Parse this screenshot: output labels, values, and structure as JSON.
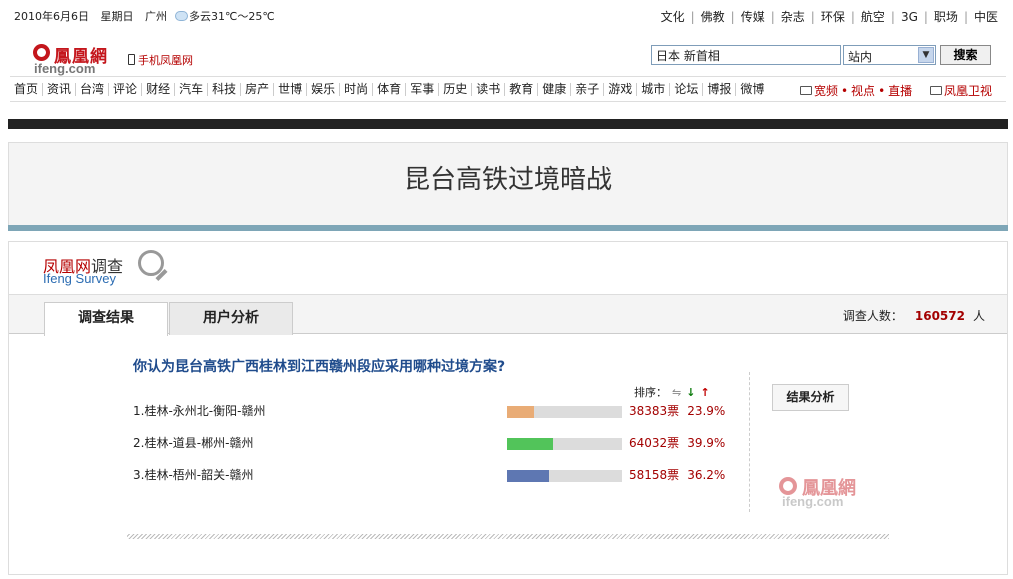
{
  "topbar": {
    "date": "2010年6月6日",
    "weekday": "星期日",
    "city": "广州",
    "weather": "多云31℃～25℃",
    "links": [
      "文化",
      "佛教",
      "传媒",
      "杂志",
      "环保",
      "航空",
      "3G",
      "职场",
      "中医"
    ]
  },
  "logo": {
    "cn": "鳳凰網",
    "en": "ifeng.com"
  },
  "mobile_link": "手机凤凰网",
  "search": {
    "value": "日本 新首相",
    "scope": "站内",
    "button": "搜索"
  },
  "nav": {
    "items": [
      "首页",
      "资讯",
      "台湾",
      "评论",
      "财经",
      "汽车",
      "科技",
      "房产",
      "世博",
      "娱乐",
      "时尚",
      "体育",
      "军事",
      "历史",
      "读书",
      "教育",
      "健康",
      "亲子",
      "游戏",
      "城市",
      "论坛",
      "博报",
      "微博"
    ],
    "right": {
      "broadband": "宽频",
      "view": "视点",
      "live": "直播",
      "tv": "凤凰卫视"
    }
  },
  "page_title": "昆台高铁过境暗战",
  "survey": {
    "logo_cn_a": "凤凰网",
    "logo_cn_b": "调查",
    "logo_en": "Ifeng Survey",
    "tabs": [
      "调查结果",
      "用户分析"
    ],
    "count_label": "调查人数：",
    "count_value": "160572",
    "count_unit": "人",
    "question": "你认为昆台高铁广西桂林到江西赣州段应采用哪种过境方案?",
    "sort_label": "排序：",
    "options": [
      {
        "label": "1.桂林-永州北-衡阳-赣州",
        "votes": "38383票",
        "percent": "23.9%",
        "ratio": 0.239,
        "color": "#e9ac76"
      },
      {
        "label": "2.桂林-道县-郴州-赣州",
        "votes": "64032票",
        "percent": "39.9%",
        "ratio": 0.399,
        "color": "#52c45a"
      },
      {
        "label": "3.桂林-梧州-韶关-赣州",
        "votes": "58158票",
        "percent": "36.2%",
        "ratio": 0.362,
        "color": "#5e77b2"
      }
    ],
    "analysis_button": "结果分析",
    "watermark_cn": "鳳凰網",
    "watermark_en": "ifeng.com"
  }
}
